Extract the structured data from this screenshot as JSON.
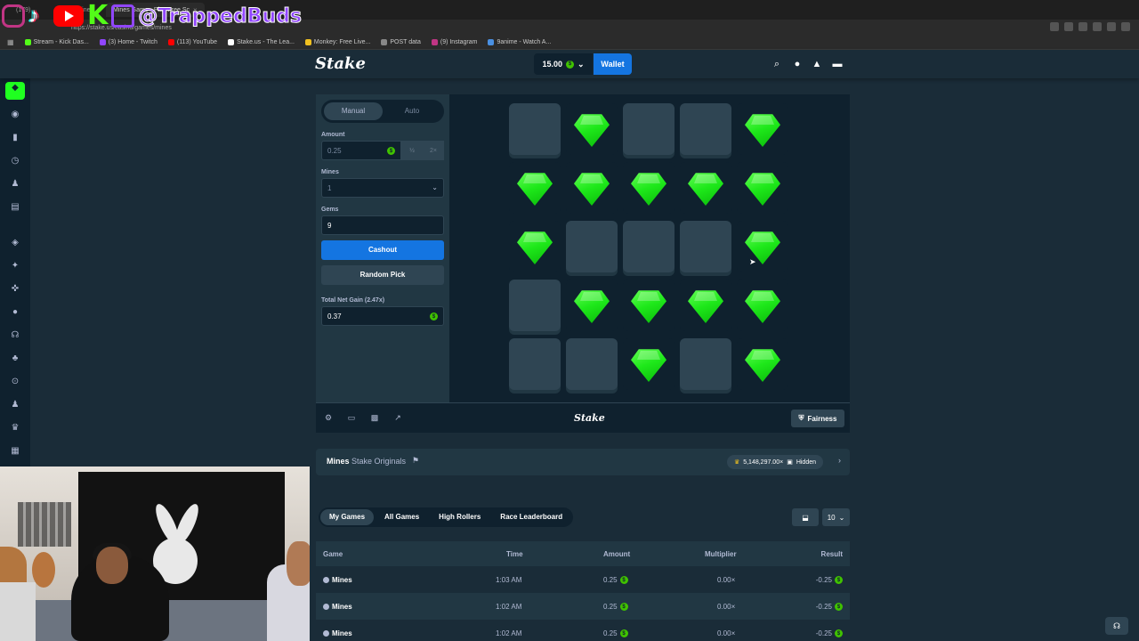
{
  "browser": {
    "tabs": [
      {
        "label": "(179)"
      },
      {
        "label": "Mines"
      },
      {
        "label": "Mines Game - Play Free Sc",
        "active": true
      }
    ],
    "url": "https://stake.us/casino/games/mines",
    "bookmarks": [
      {
        "label": "Stream - Kick Das...",
        "color": "#53fc18"
      },
      {
        "label": "(3) Home - Twitch",
        "color": "#9146ff"
      },
      {
        "label": "(113) YouTube",
        "color": "#ff0000"
      },
      {
        "label": "Stake.us - The Lea...",
        "color": "#ffffff"
      },
      {
        "label": "Monkey: Free Live...",
        "color": "#f0c020"
      },
      {
        "label": "POST data",
        "color": "#888888"
      },
      {
        "label": "(9) Instagram",
        "color": "#c13584"
      },
      {
        "label": "9anime - Watch A...",
        "color": "#4a90e2"
      }
    ]
  },
  "overlay": {
    "handle": "@TrappedBuds"
  },
  "header": {
    "logo": "Stake",
    "balance": "15.00",
    "wallet_label": "Wallet"
  },
  "controls": {
    "mode_manual": "Manual",
    "mode_auto": "Auto",
    "amount_label": "Amount",
    "amount_value": "0.25",
    "half_label": "½",
    "double_label": "2×",
    "mines_label": "Mines",
    "mines_value": "1",
    "gems_label": "Gems",
    "gems_value": "9",
    "cashout_label": "Cashout",
    "random_label": "Random Pick",
    "net_gain_label": "Total Net Gain (2.47x)",
    "net_gain_value": "0.37"
  },
  "board": {
    "grid": [
      [
        "hidden",
        "gem",
        "hidden",
        "hidden",
        "gem"
      ],
      [
        "gem",
        "gem",
        "gem",
        "gem",
        "gem"
      ],
      [
        "gem",
        "hidden",
        "hidden",
        "hidden",
        "gem"
      ],
      [
        "hidden",
        "gem",
        "gem",
        "gem",
        "gem"
      ],
      [
        "hidden",
        "hidden",
        "gem",
        "hidden",
        "gem"
      ]
    ]
  },
  "footer": {
    "logo": "Stake",
    "fairness_label": "Fairness"
  },
  "info": {
    "title": "Mines",
    "subtitle": "Stake Originals",
    "stat": "5,148,297.00×",
    "hidden_label": "Hidden"
  },
  "tabs": [
    "My Games",
    "All Games",
    "High Rollers",
    "Race Leaderboard"
  ],
  "page_size": "10",
  "table": {
    "headers": [
      "Game",
      "Time",
      "Amount",
      "Multiplier",
      "Result"
    ],
    "rows": [
      {
        "game": "Mines",
        "time": "1:03 AM",
        "amount": "0.25",
        "multiplier": "0.00×",
        "result": "-0.25"
      },
      {
        "game": "Mines",
        "time": "1:02 AM",
        "amount": "0.25",
        "multiplier": "0.00×",
        "result": "-0.25"
      },
      {
        "game": "Mines",
        "time": "1:02 AM",
        "amount": "0.25",
        "multiplier": "0.00×",
        "result": "-0.25"
      }
    ]
  },
  "colors": {
    "accent": "#1475e1",
    "gem": "#1fff20",
    "bg": "#1a2c38",
    "panel": "#213743"
  }
}
